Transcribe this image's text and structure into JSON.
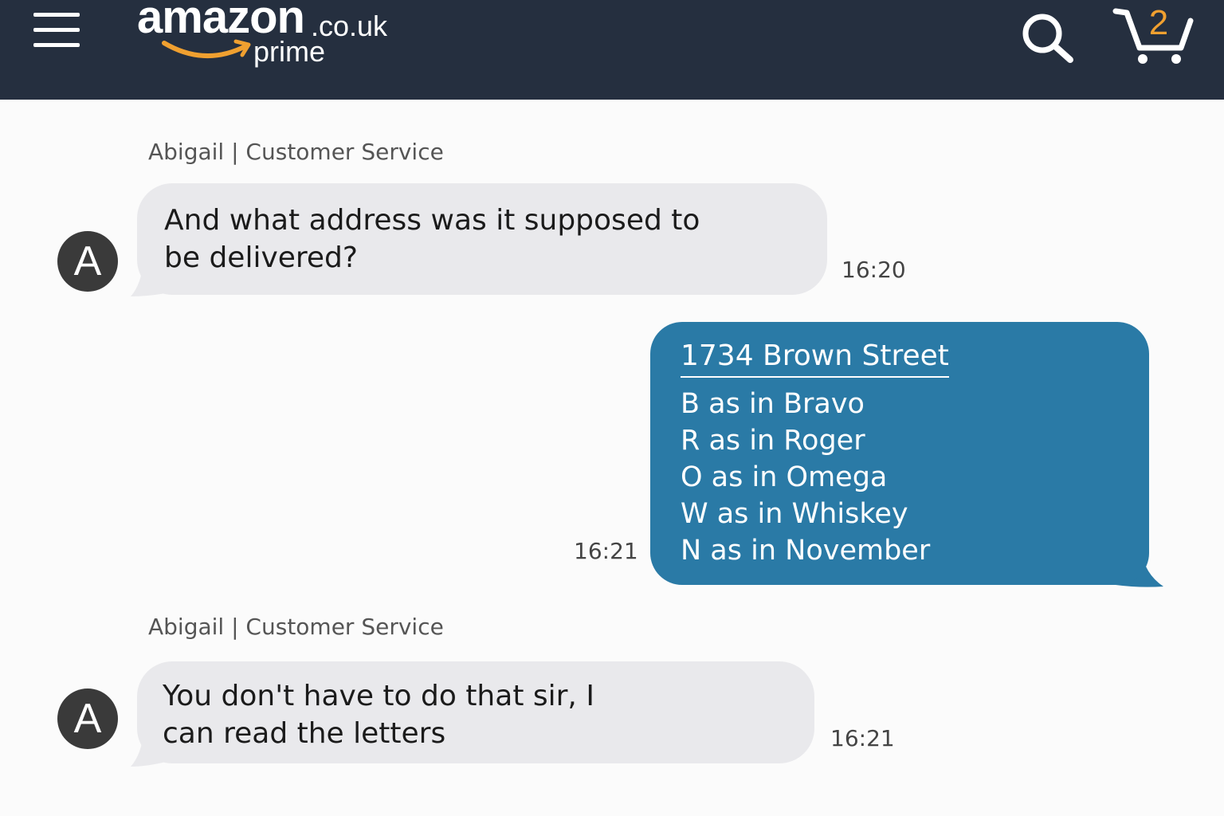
{
  "header": {
    "logo_word": "amazon",
    "logo_tld": ".co.uk",
    "logo_sub": "prime",
    "cart_count": "2"
  },
  "messages": [
    {
      "sender": "Abigail | Customer Service",
      "avatar_letter": "A",
      "lines": [
        "And what address was it supposed to",
        "be delivered?"
      ],
      "time": "16:20"
    },
    {
      "heading": "1734 Brown Street",
      "lines": [
        "B as in Bravo",
        "R as in Roger",
        "O as in Omega",
        "W as in Whiskey",
        "N as in November"
      ],
      "time": "16:21"
    },
    {
      "sender": "Abigail | Customer Service",
      "avatar_letter": "A",
      "lines": [
        "You don't have to do that sir, I",
        "can read the letters"
      ],
      "time": "16:21"
    }
  ],
  "colors": {
    "header_bg": "#252f3f",
    "incoming_bubble": "#e9e9ec",
    "outgoing_bubble": "#2a7aa6",
    "cart_count": "#f0a030",
    "smile": "#f0a030"
  },
  "icons": [
    "menu-icon",
    "search-icon",
    "cart-icon"
  ]
}
